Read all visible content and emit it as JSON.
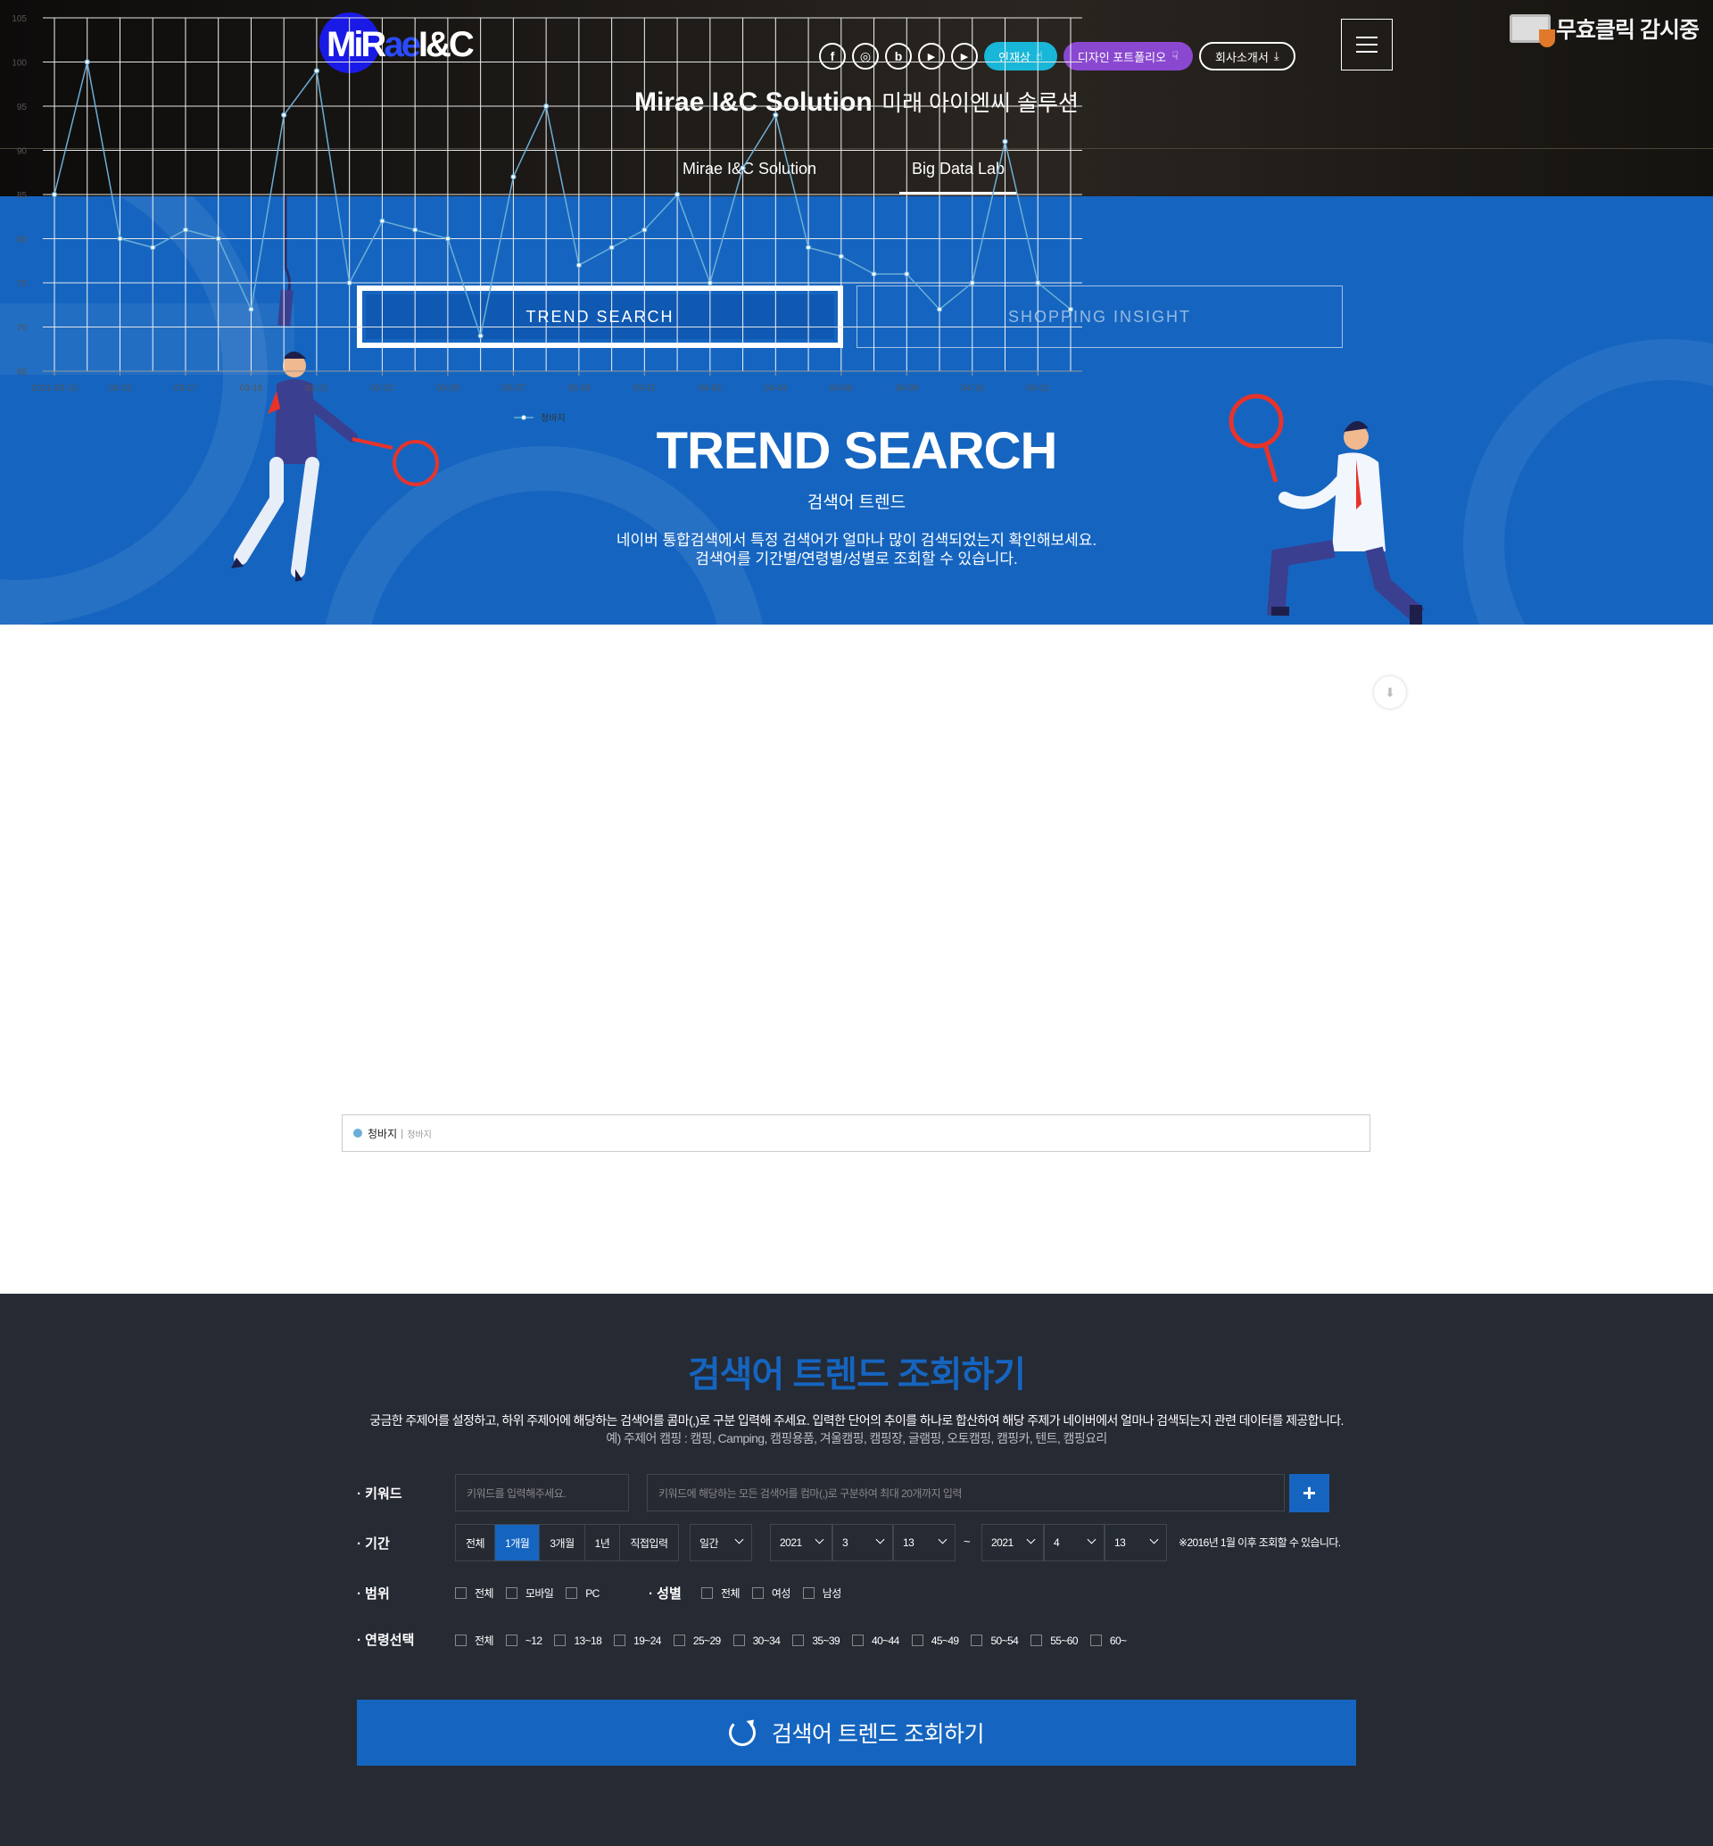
{
  "header": {
    "logo_text": "MiRae I&C",
    "sns": [
      {
        "name": "facebook-icon",
        "glyph": "f"
      },
      {
        "name": "instagram-icon",
        "glyph": "◎"
      },
      {
        "name": "blog-icon",
        "glyph": "b"
      },
      {
        "name": "play-icon",
        "glyph": "▶"
      },
      {
        "name": "youtube-icon",
        "glyph": "▶"
      }
    ],
    "pill_award": "인재상",
    "pill_portfolio": "디자인 포트폴리오",
    "pill_company": "회사소개서",
    "monitor_text": "무효클릭 감시중",
    "title_en": "Mirae I&C Solution",
    "title_ko": "미래 아이엔씨 솔루션",
    "subnav": [
      "Mirae I&C Solution",
      "Big Data Lab"
    ]
  },
  "hero": {
    "tab_trend": "TREND SEARCH",
    "tab_shopping": "SHOPPING INSIGHT",
    "title": "TREND SEARCH",
    "subtitle": "검색어 트렌드",
    "desc_line1": "네이버 통합검색에서 특정 검색어가 얼마나 많이 검색되었는지 확인해보세요.",
    "desc_line2": "검색어를 기간별/연령별/성별로 조회할 수 있습니다.",
    "colors": {
      "hero_bg": "#1565c0"
    }
  },
  "chart_data": {
    "type": "line",
    "x": [
      "2021-03-13",
      "03-14",
      "03-15",
      "03-16",
      "03-17",
      "03-18",
      "03-19",
      "03-20",
      "03-21",
      "03-22",
      "03-23",
      "03-24",
      "03-25",
      "03-26",
      "03-27",
      "03-28",
      "03-29",
      "03-30",
      "03-31",
      "04-01",
      "04-02",
      "04-03",
      "04-04",
      "04-05",
      "04-06",
      "04-07",
      "04-08",
      "04-09",
      "04-10",
      "04-11",
      "04-12",
      "04-13"
    ],
    "x_tick_labels": [
      "2021-03-13",
      "03-15",
      "03-17",
      "03-19",
      "03-21",
      "03-23",
      "03-25",
      "03-27",
      "03-29",
      "03-31",
      "04-02",
      "04-04",
      "04-06",
      "04-08",
      "04-10",
      "04-12"
    ],
    "series": [
      {
        "name": "청바지",
        "color": "#6baed6",
        "values": [
          85,
          100,
          80,
          79,
          81,
          80,
          72,
          94,
          99,
          75,
          82,
          81,
          80,
          69,
          87,
          95,
          77,
          79,
          81,
          85,
          75,
          88,
          94,
          79,
          78,
          76,
          76,
          72,
          75,
          91,
          75,
          72
        ]
      }
    ],
    "ylim": [
      65,
      105
    ],
    "y_ticks": [
      65,
      70,
      75,
      80,
      85,
      90,
      95,
      100,
      105
    ],
    "legend": "bottom",
    "grid": true
  },
  "legend_box": {
    "keyword": "청바지",
    "sub": "청바지"
  },
  "search": {
    "title": "검색어 트렌드 조회하기",
    "desc": "궁금한 주제어를 설정하고, 하위 주제어에 해당하는 검색어를 콤마(,)로 구분 입력해 주세요. 입력한 단어의 추이를 하나로 합산하여 해당 주제가 네이버에서 얼마나 검색되는지 관련 데이터를 제공합니다.",
    "example": "예) 주제어 캠핑 : 캠핑, Camping, 캠핑용품, 겨울캠핑, 캠핑장, 글램핑, 오토캠핑, 캠핑카, 텐트, 캠핑요리",
    "label_keyword": "· 키워드",
    "label_period": "· 기간",
    "label_scope": "· 범위",
    "label_gender": "· 성별",
    "label_age": "· 연령선택",
    "keyword_placeholder": "키워드를 입력해주세요.",
    "subkeyword_placeholder": "키워드에 해당하는 모든 검색어를 컴마(,)로 구분하여 최대 20개까지 입력",
    "period_options": [
      "전체",
      "1개월",
      "3개월",
      "1년",
      "직접입력"
    ],
    "period_active": "1개월",
    "interval": "일간",
    "start": {
      "year": "2021",
      "month": "3",
      "day": "13"
    },
    "end": {
      "year": "2021",
      "month": "4",
      "day": "13"
    },
    "tilde": "~",
    "period_note": "※2016년 1월 이후 조회할 수 있습니다.",
    "scope_options": [
      "전체",
      "모바일",
      "PC"
    ],
    "gender_options": [
      "전체",
      "여성",
      "남성"
    ],
    "age_options": [
      "전체",
      "~12",
      "13~18",
      "19~24",
      "25~29",
      "30~34",
      "35~39",
      "40~44",
      "45~49",
      "50~54",
      "55~60",
      "60~"
    ],
    "submit_label": "검색어 트렌드 조회하기",
    "colors": {
      "section_bg": "#262a33",
      "accent": "#1565c0"
    }
  }
}
